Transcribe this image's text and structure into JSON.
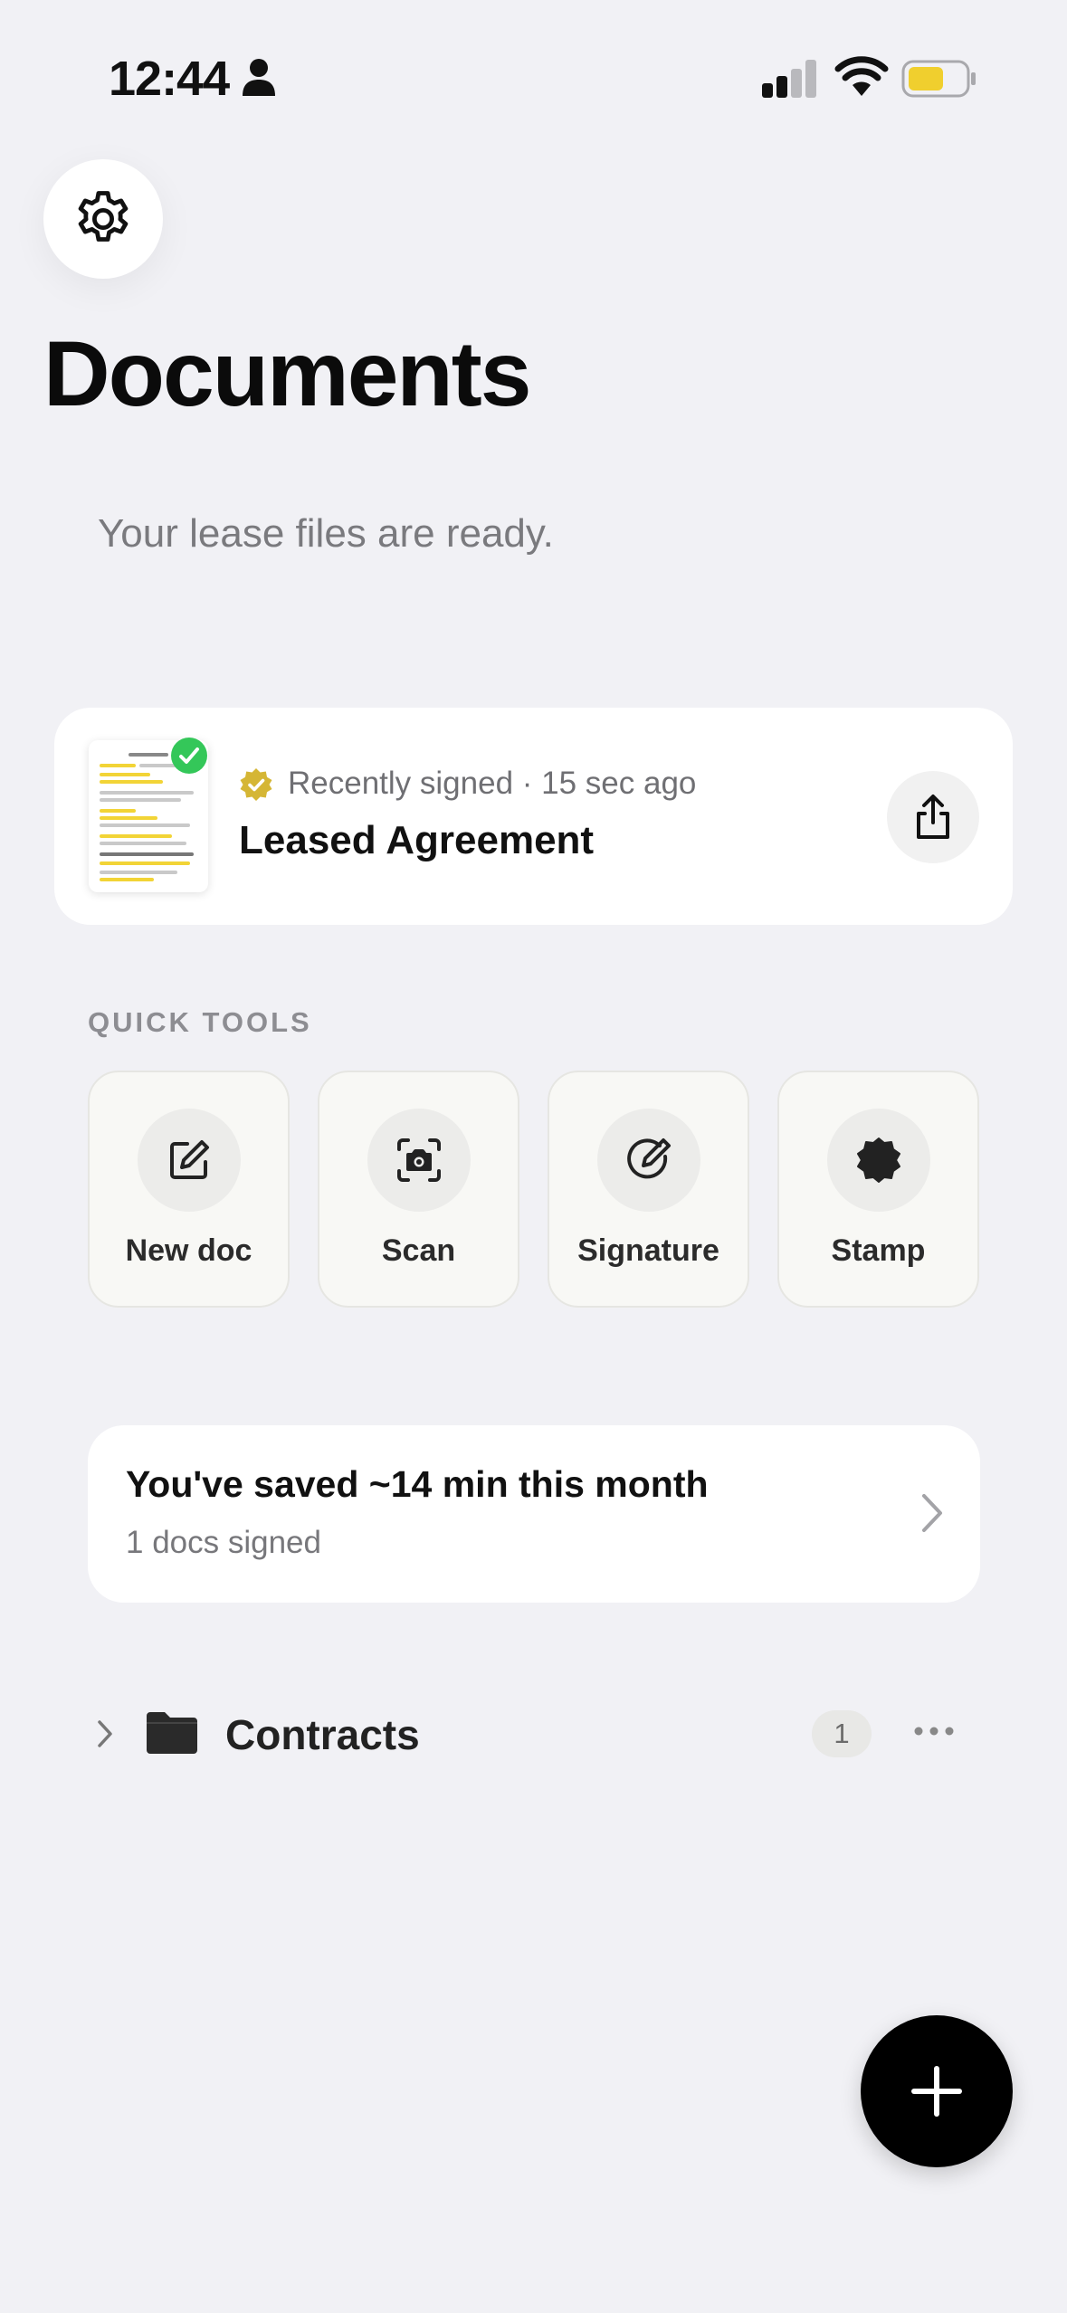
{
  "status_bar": {
    "time": "12:44",
    "icons": [
      "person-icon",
      "signal-icon",
      "wifi-icon",
      "battery-icon"
    ],
    "battery_color": "#f0cf2e"
  },
  "header": {
    "settings_icon": "gear-icon",
    "title": "Documents",
    "subtitle": "Your lease files are ready."
  },
  "recent_document": {
    "status": "Recently signed · 15 sec ago",
    "title": "Leased Agreement",
    "badge_color": "#d5b635",
    "check_color": "#34c759",
    "share_icon": "share-icon"
  },
  "quick_tools": {
    "label": "QUICK TOOLS",
    "items": [
      {
        "label": "New doc",
        "icon": "edit-icon"
      },
      {
        "label": "Scan",
        "icon": "camera-scan-icon"
      },
      {
        "label": "Signature",
        "icon": "signature-icon"
      },
      {
        "label": "Stamp",
        "icon": "stamp-icon"
      }
    ]
  },
  "savings": {
    "title": "You've saved ~14 min this month",
    "subtitle": "1 docs signed"
  },
  "folders": [
    {
      "name": "Contracts",
      "count": "1"
    }
  ],
  "fab": {
    "icon": "plus-icon"
  }
}
